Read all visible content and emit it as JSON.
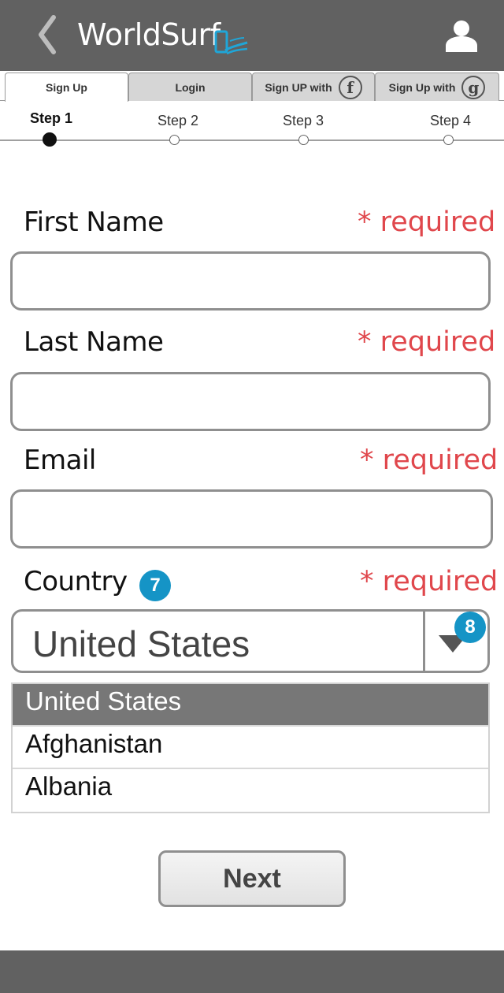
{
  "header": {
    "title": "WorldSurf",
    "back_icon": "chevron-left-icon",
    "logo_icon": "surf-phone-logo-icon",
    "user_icon": "user-icon",
    "background": "#616161"
  },
  "tabs": [
    {
      "label": "Sign Up",
      "active": true
    },
    {
      "label": "Login",
      "active": false
    },
    {
      "label": "Sign UP with",
      "icon": "facebook-icon",
      "icon_glyph": "f",
      "active": false
    },
    {
      "label": "Sign Up with",
      "icon": "google-icon",
      "icon_glyph": "g",
      "active": false
    }
  ],
  "steps": [
    {
      "label": "Step 1",
      "current": true
    },
    {
      "label": "Step 2",
      "current": false
    },
    {
      "label": "Step 3",
      "current": false
    },
    {
      "label": "Step 4",
      "current": false
    }
  ],
  "form": {
    "first_name": {
      "label": "First Name",
      "required": "* required",
      "value": ""
    },
    "last_name": {
      "label": "Last Name",
      "required": "* required",
      "value": ""
    },
    "email": {
      "label": "Email",
      "required": "* required",
      "value": ""
    },
    "country": {
      "label": "Country",
      "required": "* required",
      "badge": "7",
      "selected": "United States",
      "dropdown_badge": "8",
      "options": [
        "United States",
        "Afghanistan",
        "Albania"
      ]
    }
  },
  "next_button": "Next",
  "colors": {
    "required": "#e0474c",
    "badge": "#1594c6",
    "selected_option": "#777777"
  }
}
